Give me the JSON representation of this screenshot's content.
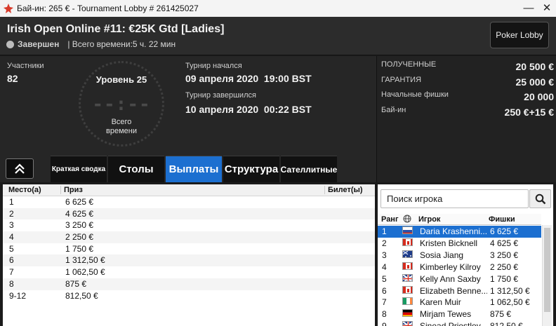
{
  "window": {
    "title": "Бай-ин: 265 € - Tournament Lobby # 261425027",
    "minimize": "—",
    "close": "✕"
  },
  "header": {
    "title": "Irish Open Online #11: €25K Gtd [Ladies]",
    "status": "Завершен",
    "total_time": "| Всего времени:5 ч. 22 мин",
    "poker_lobby": "Poker Lobby"
  },
  "info": {
    "participants_label": "Участники",
    "participants": "82",
    "level": "Уровень 25",
    "clock": "--:--",
    "clock_label_1": "Всего",
    "clock_label_2": "времени",
    "started_label": "Турнир начался",
    "started": "09 апреля 2020  19:00 BST",
    "ended_label": "Турнир завершился",
    "ended": "10 апреля 2020  00:22 BST",
    "right": [
      {
        "label": "Полученные",
        "value": "20 500 €"
      },
      {
        "label": "Гарантия",
        "value": "25 000 €"
      },
      {
        "label": "Начальные фишки",
        "value": "20 000"
      },
      {
        "label": "Бай-ин",
        "value": "250 €+15 €"
      }
    ]
  },
  "collapse_icon": "chevron-up-double",
  "tabs": [
    {
      "label": "Краткая сводка",
      "size": "small"
    },
    {
      "label": "Столы",
      "size": "big"
    },
    {
      "label": "Выплаты",
      "size": "big",
      "active": true
    },
    {
      "label": "Структура",
      "size": "big"
    },
    {
      "label": "Сателлитные",
      "size": "mid"
    }
  ],
  "payouts": {
    "headers": [
      "Место(а)",
      "Приз",
      "Билет(ы)"
    ],
    "rows": [
      {
        "place": "1",
        "prize": "6 625 €"
      },
      {
        "place": "2",
        "prize": "4 625 €"
      },
      {
        "place": "3",
        "prize": "3 250 €"
      },
      {
        "place": "4",
        "prize": "2 250 €"
      },
      {
        "place": "5",
        "prize": "1 750 €"
      },
      {
        "place": "6",
        "prize": "1 312,50 €"
      },
      {
        "place": "7",
        "prize": "1 062,50 €"
      },
      {
        "place": "8",
        "prize": "875 €"
      },
      {
        "place": "9-12",
        "prize": "812,50 €"
      }
    ]
  },
  "players": {
    "search_placeholder": "Поиск игрока",
    "headers": [
      "Ранг",
      "Игрок",
      "Фишки"
    ],
    "rows": [
      {
        "rank": "1",
        "flag": "ru",
        "name": "Daria Krashenni...",
        "chips": "6 625 €"
      },
      {
        "rank": "2",
        "flag": "ca",
        "name": "Kristen Bicknell",
        "chips": "4 625 €"
      },
      {
        "rank": "3",
        "flag": "au",
        "name": "Sosia Jiang",
        "chips": "3 250 €"
      },
      {
        "rank": "4",
        "flag": "ca",
        "name": "Kimberley Kilroy",
        "chips": "2 250 €"
      },
      {
        "rank": "5",
        "flag": "gb",
        "name": "Kelly Ann Saxby",
        "chips": "1 750 €"
      },
      {
        "rank": "6",
        "flag": "ca",
        "name": "Elizabeth Benne...",
        "chips": "1 312,50 €"
      },
      {
        "rank": "7",
        "flag": "ie",
        "name": "Karen Muir",
        "chips": "1 062,50 €"
      },
      {
        "rank": "8",
        "flag": "de",
        "name": "Mirjam Tewes",
        "chips": "875 €"
      },
      {
        "rank": "9",
        "flag": "gb",
        "name": "Sinead Priestley",
        "chips": "812,50 €"
      }
    ]
  },
  "colors": {
    "accent": "#1c6fd0",
    "panel": "#262626",
    "header": "#2c2c2c"
  }
}
